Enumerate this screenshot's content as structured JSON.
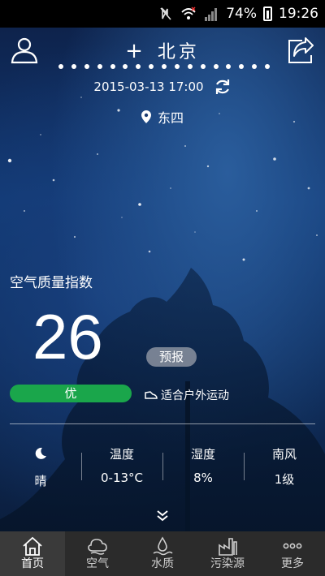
{
  "status_bar": {
    "battery": "74%",
    "time": "19:26"
  },
  "header": {
    "add_symbol": "+",
    "city": "北京",
    "page_dots_count": 17,
    "datetime": "2015-03-13 17:00",
    "station": "东四"
  },
  "aqi": {
    "label": "空气质量指数",
    "value": "26",
    "forecast_button": "预报",
    "level": "优",
    "level_color": "#1aa64b",
    "suggestion": "适合户外运动"
  },
  "stats": {
    "weather": {
      "icon": "moon-icon",
      "text": "晴"
    },
    "temperature": {
      "label": "温度",
      "value": "0-13°C"
    },
    "humidity": {
      "label": "湿度",
      "value": "8%"
    },
    "wind": {
      "label": "南风",
      "value": "1级"
    }
  },
  "nav": {
    "items": [
      {
        "label": "首页",
        "icon": "home-icon",
        "active": true
      },
      {
        "label": "空气",
        "icon": "air-icon",
        "active": false
      },
      {
        "label": "水质",
        "icon": "water-icon",
        "active": false
      },
      {
        "label": "污染源",
        "icon": "factory-icon",
        "active": false
      },
      {
        "label": "更多",
        "icon": "more-icon",
        "active": false
      }
    ]
  }
}
